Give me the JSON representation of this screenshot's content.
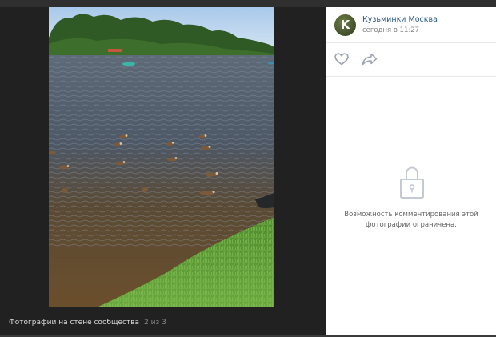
{
  "post": {
    "group_name": "Кузьминки Москва",
    "time": "сегодня в 11:27",
    "avatar_letter": "K"
  },
  "viewer": {
    "caption": "Фотографии на стене сообщества",
    "counter": "2 из 3"
  },
  "comments": {
    "restricted_text": "Возможность комментирования этой фотографии ограничена."
  },
  "icons": {
    "like": "heart-icon",
    "share": "share-arrow-icon",
    "lock": "lock-icon"
  },
  "colors": {
    "link": "#2a5885",
    "viewer_bg": "#212121",
    "panel_bg": "#ffffff",
    "muted_text": "#828282"
  }
}
